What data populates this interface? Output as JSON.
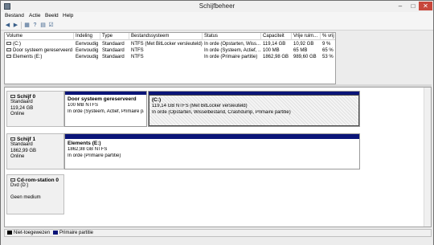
{
  "window": {
    "title": "Schijfbeheer",
    "controls": {
      "minimize": "–",
      "maximize": "□",
      "close": "✕"
    }
  },
  "menu": [
    "Bestand",
    "Actie",
    "Beeld",
    "Help"
  ],
  "toolbar": [
    "back-icon",
    "forward-icon",
    "properties-icon",
    "help-icon",
    "connect-icon",
    "settings-icon"
  ],
  "volume_list": {
    "columns": [
      "Volume",
      "Indeling",
      "Type",
      "Bestandssysteem",
      "Status",
      "Capaciteit",
      "Vrije ruim...",
      "% vrij"
    ],
    "rows": [
      [
        "(C:)",
        "Eenvoudig",
        "Standaard",
        "NTFS (Met BitLocker versleuteld)",
        "In orde (Opstarten, Wiss...",
        "119,14 GB",
        "10,92 GB",
        "9 %"
      ],
      [
        "Door systeem gereserveerd",
        "Eenvoudig",
        "Standaard",
        "NTFS",
        "In orde (Systeem, Actief, ...",
        "100 MB",
        "65 MB",
        "65 %"
      ],
      [
        "Elements (E:)",
        "Eenvoudig",
        "Standaard",
        "NTFS",
        "In orde (Primaire partitie)",
        "1862,98 GB",
        "989,60 GB",
        "53 %"
      ]
    ]
  },
  "disks": [
    {
      "name": "Schijf 0",
      "lines": [
        "Standaard",
        "119,24 GB",
        "Online"
      ],
      "partitions": [
        {
          "title": "Door systeem gereserveerd",
          "lines": [
            "100 MB NTFS",
            "In orde (Systeem, Actief, Primaire par"
          ]
        },
        {
          "title": "(C:)",
          "lines": [
            "119,14 GB NTFS (Met BitLocker versleuteld)",
            "In orde (Opstarten, Wisselbestand, Crashdump, Primaire partitie)"
          ]
        }
      ]
    },
    {
      "name": "Schijf 1",
      "lines": [
        "Standaard",
        "1862,99 GB",
        "Online"
      ],
      "partitions": [
        {
          "title": "Elements  (E:)",
          "lines": [
            "1862,98 GB NTFS",
            "In orde (Primaire partitie)"
          ]
        }
      ]
    },
    {
      "name": "Cd-rom-station 0",
      "lines": [
        "Dvd (D:)",
        "",
        "Geen medium"
      ],
      "partitions": []
    }
  ],
  "legend": [
    {
      "label": "Niet-toegewezen",
      "color": "#000000"
    },
    {
      "label": "Primaire partitie",
      "color": "#0a1478"
    }
  ]
}
